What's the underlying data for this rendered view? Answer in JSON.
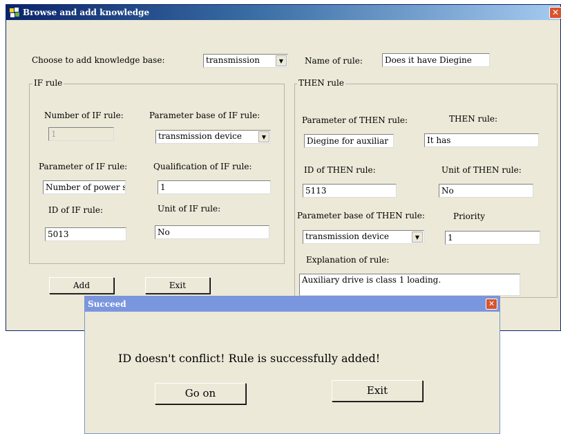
{
  "main_window": {
    "title": "Browse and add knowledge",
    "close_glyph": "✕",
    "knowledge_base_label": "Choose to add knowledge base:",
    "knowledge_base_value": "transmission",
    "rule_name_label": "Name of rule:",
    "rule_name_value": "Does it have Diegine",
    "if_group": {
      "legend": "IF rule",
      "number_label": "Number of IF rule:",
      "number_value": "1",
      "param_base_label": "Parameter base of IF rule:",
      "param_base_value": "transmission device",
      "param_label": "Parameter of IF rule:",
      "param_value": "Number of power sup",
      "qualification_label": "Qualification of IF rule:",
      "qualification_value": "1",
      "id_label": "ID of IF rule:",
      "id_value": "5013",
      "unit_label": "Unit of IF rule:",
      "unit_value": "No"
    },
    "then_group": {
      "legend": "THEN rule",
      "param_label": "Parameter of THEN rule:",
      "param_value": "Diegine for auxiliar",
      "rule_label": "THEN rule:",
      "rule_value": "It has",
      "id_label": "ID of THEN rule:",
      "id_value": "5113",
      "unit_label": "Unit of THEN rule:",
      "unit_value": "No",
      "param_base_label": "Parameter base of THEN rule:",
      "param_base_value": "transmission device",
      "priority_label": "Priority",
      "priority_value": "1",
      "explanation_label": "Explanation of rule:",
      "explanation_value": "Auxiliary drive is class 1 loading."
    },
    "add_button": "Add",
    "exit_button": "Exit"
  },
  "dialog": {
    "title": "Succeed",
    "close_glyph": "✕",
    "message": "ID doesn't conflict! Rule is successfully added!",
    "go_on_button": "Go on",
    "exit_button": "Exit"
  },
  "colors": {
    "window_bg": "#ece9d8",
    "titlebar_dark": "#0a246a",
    "dialog_titlebar": "#7a96df",
    "close_button": "#d8532e"
  },
  "icons": [
    "app-icon",
    "close-icon",
    "dropdown-arrow-icon"
  ]
}
